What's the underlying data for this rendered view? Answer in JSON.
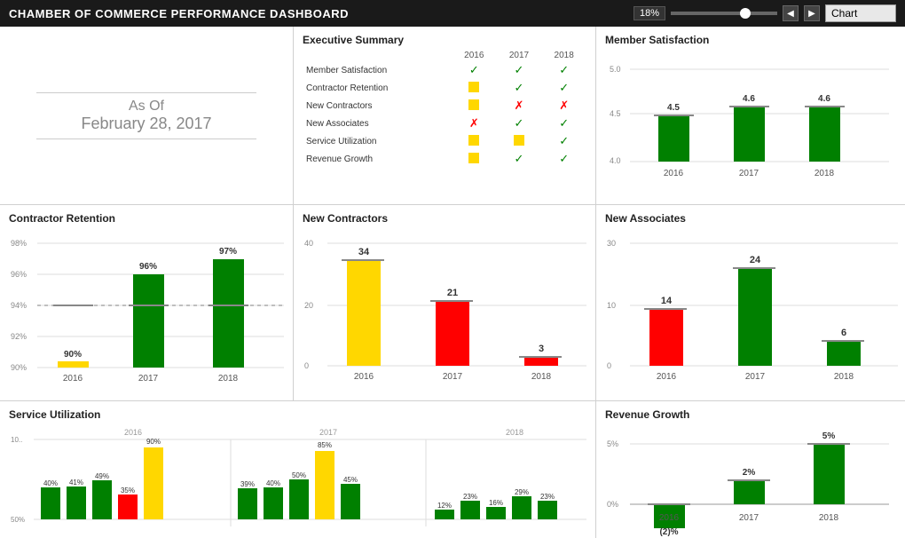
{
  "header": {
    "title": "CHAMBER OF COMMERCE PERFORMANCE DASHBOARD",
    "zoom": "18%",
    "chart_label": "Chart",
    "nav_left": "◀",
    "nav_right": "▶"
  },
  "as_of": {
    "label": "As Of",
    "date": "February 28, 2017"
  },
  "executive_summary": {
    "title": "Executive Summary",
    "columns": [
      "",
      "2016",
      "2017",
      "2018"
    ],
    "rows": [
      {
        "label": "Member Satisfaction",
        "2016": "check",
        "2017": "check",
        "2018": "check"
      },
      {
        "label": "Contractor Retention",
        "2016": "yellow",
        "2017": "check",
        "2018": "check"
      },
      {
        "label": "New Contractors",
        "2016": "yellow",
        "2017": "x",
        "2018": "x"
      },
      {
        "label": "New Associates",
        "2016": "x_red",
        "2017": "check",
        "2018": "check"
      },
      {
        "label": "Service Utilization",
        "2016": "yellow",
        "2017": "yellow",
        "2018": "check"
      },
      {
        "label": "Revenue Growth",
        "2016": "yellow",
        "2017": "check",
        "2018": "check"
      }
    ]
  },
  "member_satisfaction": {
    "title": "Member Satisfaction",
    "y_max": 5.0,
    "y_min": 4.0,
    "y_labels": [
      "5.0",
      "4.5",
      "4.0"
    ],
    "bars": [
      {
        "year": "2016",
        "value": 4.5,
        "color": "green"
      },
      {
        "year": "2017",
        "value": 4.6,
        "color": "green"
      },
      {
        "year": "2018",
        "value": 4.6,
        "color": "green"
      }
    ]
  },
  "contractor_retention": {
    "title": "Contractor Retention",
    "y_labels": [
      "98%",
      "96%",
      "94%",
      "92%",
      "90%"
    ],
    "bars": [
      {
        "year": "2016",
        "value": 90,
        "label": "90%",
        "color": "#FFD700"
      },
      {
        "year": "2017",
        "value": 96,
        "label": "96%",
        "color": "green"
      },
      {
        "year": "2018",
        "value": 97,
        "label": "97%",
        "color": "green"
      }
    ],
    "target": 94
  },
  "new_contractors": {
    "title": "New Contractors",
    "bars": [
      {
        "year": "2016",
        "value": 34,
        "label": "34",
        "color": "#FFD700"
      },
      {
        "year": "2017",
        "value": 21,
        "label": "21",
        "color": "red"
      },
      {
        "year": "2018",
        "value": 3,
        "label": "3",
        "color": "red"
      }
    ]
  },
  "new_associates": {
    "title": "New Associates",
    "bars": [
      {
        "year": "2016",
        "value": 14,
        "label": "14",
        "color": "red"
      },
      {
        "year": "2017",
        "value": 24,
        "label": "24",
        "color": "green"
      },
      {
        "year": "2018",
        "value": 6,
        "label": "6",
        "color": "green"
      }
    ]
  },
  "service_utilization": {
    "title": "Service Utilization",
    "year_groups": [
      {
        "year": "2016",
        "bars": [
          {
            "label": "40%",
            "value": 40,
            "color": "green"
          },
          {
            "label": "41%",
            "value": 41,
            "color": "green"
          },
          {
            "label": "49%",
            "value": 49,
            "color": "green"
          },
          {
            "label": "35%",
            "value": 35,
            "color": "red"
          },
          {
            "label": "90%",
            "value": 90,
            "color": "#FFD700"
          }
        ]
      },
      {
        "year": "2017",
        "bars": [
          {
            "label": "39%",
            "value": 39,
            "color": "green"
          },
          {
            "label": "40%",
            "value": 40,
            "color": "green"
          },
          {
            "label": "50%",
            "value": 50,
            "color": "green"
          },
          {
            "label": "85%",
            "value": 85,
            "color": "#FFD700"
          },
          {
            "label": "45%",
            "value": 45,
            "color": "green"
          }
        ]
      },
      {
        "year": "2018",
        "bars": [
          {
            "label": "12%",
            "value": 12,
            "color": "green"
          },
          {
            "label": "23%",
            "value": 23,
            "color": "green"
          },
          {
            "label": "16%",
            "value": 16,
            "color": "green"
          },
          {
            "label": "29%",
            "value": 29,
            "color": "green"
          },
          {
            "label": "23%",
            "value": 23,
            "color": "green"
          }
        ]
      }
    ]
  },
  "revenue_growth": {
    "title": "Revenue Growth",
    "bars": [
      {
        "year": "2016",
        "value": -2,
        "label": "(2)%",
        "color": "green"
      },
      {
        "year": "2017",
        "value": 2,
        "label": "2%",
        "color": "green"
      },
      {
        "year": "2018",
        "value": 5,
        "label": "5%",
        "color": "green"
      }
    ]
  }
}
